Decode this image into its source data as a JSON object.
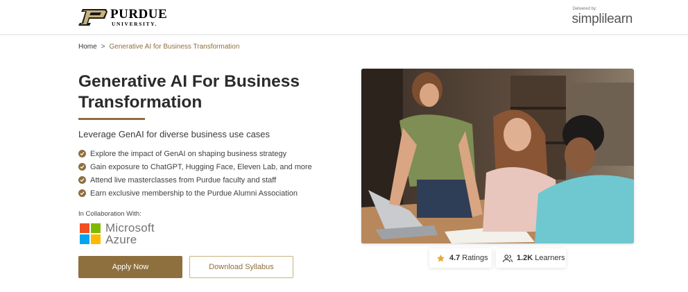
{
  "header": {
    "purdue_name": "PURDUE",
    "purdue_sub": "UNIVERSITY.",
    "delivered_by": "Delivered by:",
    "partner_name": "simplilearn"
  },
  "breadcrumb": {
    "home": "Home",
    "separator": ">",
    "current": "Generative AI for Business Transformation"
  },
  "hero": {
    "title": "Generative AI For Business Transformation",
    "subtitle": "Leverage GenAI for diverse business use cases",
    "features": [
      "Explore the impact of GenAI on shaping business strategy",
      "Gain exposure to ChatGPT, Hugging Face, Eleven Lab, and more",
      "Attend live masterclasses from Purdue faculty and staff",
      "Earn exclusive membership to the Purdue Alumni Association"
    ],
    "collab_label": "In Collaboration With:",
    "collab_partner_line1": "Microsoft",
    "collab_partner_line2": "Azure"
  },
  "actions": {
    "apply": "Apply Now",
    "syllabus": "Download Syllabus"
  },
  "stats": {
    "rating_value": "4.7",
    "rating_label": "Ratings",
    "learners_value": "1.2K",
    "learners_label": "Learners"
  },
  "colors": {
    "brand_gold": "#8e6f3e",
    "text_dark": "#2b2b2b",
    "ms_red": "#f25022",
    "ms_green": "#7fba00",
    "ms_blue": "#00a4ef",
    "ms_yellow": "#ffb900",
    "star": "#e8a838"
  },
  "icons": {
    "check": "check-circle-icon",
    "star": "star-icon",
    "learners": "people-icon"
  }
}
